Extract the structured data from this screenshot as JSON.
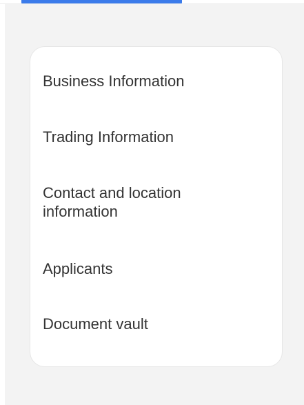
{
  "nav": {
    "items": [
      {
        "label": "Business Information"
      },
      {
        "label": "Trading Information"
      },
      {
        "label": "Contact and location information"
      },
      {
        "label": "Applicants"
      },
      {
        "label": "Document vault"
      }
    ]
  },
  "colors": {
    "accent": "#3b7bea",
    "background": "#f3f3f3",
    "card": "#ffffff",
    "text": "#333333"
  }
}
